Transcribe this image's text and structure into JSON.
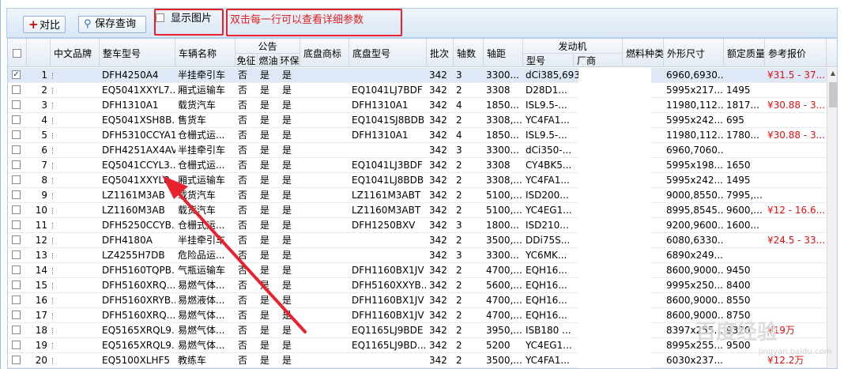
{
  "toolbar": {
    "compare_label": "对比",
    "save_query_label": "保存查询",
    "show_pic_label": "显示图片",
    "hint": "双击每一行可以查看详细参数"
  },
  "colors": {
    "hint_red": "#e02020",
    "price_red": "#e01010",
    "selected_row": "#dfe8f6",
    "annotation_red": "#e8232f"
  },
  "columns": {
    "cn_brand": "中文品牌",
    "model": "整车型号",
    "vehicle_name": "车辆名称",
    "announcement": "公告",
    "ann_exempt": "免征",
    "ann_fuel": "燃油",
    "ann_env": "环保",
    "chassis_brand": "底盘商标",
    "chassis_model": "底盘型号",
    "batch": "批次",
    "axles": "轴数",
    "wheelbase": "轴距",
    "engine": "发动机",
    "engine_model": "型号",
    "engine_maker": "厂商",
    "fuel_type": "燃料种类",
    "dimensions": "外形尺寸",
    "rated_mass": "额定质量",
    "ref_price": "参考报价"
  },
  "rows": [
    {
      "n": "1",
      "model": "DFH4250A4",
      "name": "半挂牵引车",
      "ex": "否",
      "fu": "是",
      "en": "是",
      "chassis": "",
      "batch": "342",
      "axles": "3",
      "wb": "3300...",
      "eng": "dCi385,6930...",
      "dim": "6960,6930...",
      "mass": "",
      "price": "¥31.5 - 37..."
    },
    {
      "n": "2",
      "model": "EQ5041XXYL7...",
      "name": "厢式运输车",
      "ex": "否",
      "fu": "是",
      "en": "是",
      "chassis": "EQ1041LJ7BDF",
      "batch": "342",
      "axles": "2",
      "wb": "3308",
      "eng": "D28D1...",
      "dim": "5995x217...",
      "mass": "1495",
      "price": ""
    },
    {
      "n": "3",
      "model": "DFH1310A1",
      "name": "载货汽车",
      "ex": "否",
      "fu": "是",
      "en": "是",
      "chassis": "DFH1310A1",
      "batch": "342",
      "axles": "4",
      "wb": "1850...",
      "eng": "ISL9.5-...",
      "dim": "11980,112...",
      "mass": "1817...",
      "price": "¥30.88 - 3..."
    },
    {
      "n": "4",
      "model": "EQ5041XSH8B...",
      "name": "售货车",
      "ex": "否",
      "fu": "是",
      "en": "是",
      "chassis": "EQ1041SJ8BDB",
      "batch": "342",
      "axles": "2",
      "wb": "3308,...",
      "eng": "YC4FA1...",
      "dim": "5995x242...",
      "mass": "695",
      "price": ""
    },
    {
      "n": "5",
      "model": "DFH5310CCYA1",
      "name": "仓栅式运...",
      "ex": "否",
      "fu": "是",
      "en": "是",
      "chassis": "DFH1310A1",
      "batch": "342",
      "axles": "4",
      "wb": "1850...",
      "eng": "ISL9.5-...",
      "dim": "11980,112...",
      "mass": "1780...",
      "price": "¥30.88 - 3..."
    },
    {
      "n": "6",
      "model": "DFH4251AX4AV",
      "name": "半挂牵引车",
      "ex": "否",
      "fu": "是",
      "en": "是",
      "chassis": "",
      "batch": "342",
      "axles": "3",
      "wb": "3300...",
      "eng": "dCi350-...",
      "dim": "6960,7060...",
      "mass": "",
      "price": ""
    },
    {
      "n": "7",
      "model": "EQ5041CCYL3...",
      "name": "仓栅式运...",
      "ex": "否",
      "fu": "是",
      "en": "是",
      "chassis": "EQ1041LJ3BDF",
      "batch": "342",
      "axles": "2",
      "wb": "3308",
      "eng": "CY4BK5...",
      "dim": "5995x198...",
      "mass": "1650",
      "price": ""
    },
    {
      "n": "8",
      "model": "EQ5041XXYL8...",
      "name": "厢式运输车",
      "ex": "否",
      "fu": "是",
      "en": "是",
      "chassis": "EQ1041LJ8BDB",
      "batch": "342",
      "axles": "2",
      "wb": "3308,...",
      "eng": "YC4FA1...",
      "dim": "5995x242...",
      "mass": "1495",
      "price": ""
    },
    {
      "n": "9",
      "model": "LZ1161M3AB",
      "name": "载货汽车",
      "ex": "否",
      "fu": "是",
      "en": "是",
      "chassis": "LZ1161M3ABT",
      "batch": "342",
      "axles": "2",
      "wb": "5100,...",
      "eng": "ISD200...",
      "dim": "9000,8550...",
      "mass": "7995,...",
      "price": ""
    },
    {
      "n": "10",
      "model": "LZ1160M3AB",
      "name": "载货汽车",
      "ex": "否",
      "fu": "是",
      "en": "是",
      "chassis": "LZ1160M3ABT",
      "batch": "342",
      "axles": "2",
      "wb": "5100,...",
      "eng": "YC4EG1...",
      "dim": "8995,8545...",
      "mass": "9600,...",
      "price": "¥12 - 16.6..."
    },
    {
      "n": "11",
      "model": "DFH5250CCYB...",
      "name": "仓栅式运...",
      "ex": "否",
      "fu": "是",
      "en": "是",
      "chassis": "DFH1250BXV",
      "batch": "342",
      "axles": "3",
      "wb": "1800...",
      "eng": "ISD210...",
      "dim": "9200,9600...",
      "mass": "1600...",
      "price": ""
    },
    {
      "n": "12",
      "model": "DFH4180A",
      "name": "半挂牵引车",
      "ex": "否",
      "fu": "是",
      "en": "是",
      "chassis": "",
      "batch": "342",
      "axles": "2",
      "wb": "3500,...",
      "eng": "DDi75S...",
      "dim": "6080,6330...",
      "mass": "",
      "price": "¥24.5 - 33..."
    },
    {
      "n": "13",
      "model": "LZ4255H7DB",
      "name": "危险品运...",
      "ex": "否",
      "fu": "是",
      "en": "是",
      "chassis": "",
      "batch": "342",
      "axles": "3",
      "wb": "3300...",
      "eng": "YC6MK...",
      "dim": "6890x249...",
      "mass": "",
      "price": ""
    },
    {
      "n": "14",
      "model": "DFH5160TQPB...",
      "name": "气瓶运输车",
      "ex": "否",
      "fu": "是",
      "en": "是",
      "chassis": "DFH1160BX1JV",
      "batch": "342",
      "axles": "2",
      "wb": "4700,...",
      "eng": "EQH16...",
      "dim": "8600,9000...",
      "mass": "9450",
      "price": ""
    },
    {
      "n": "15",
      "model": "DFH5160XRQ...",
      "name": "易燃气体...",
      "ex": "否",
      "fu": "是",
      "en": "是",
      "chassis": "DFH5160XXYB...",
      "batch": "342",
      "axles": "2",
      "wb": "5600,...",
      "eng": "EQH16...",
      "dim": "9995x250...",
      "mass": "8400",
      "price": ""
    },
    {
      "n": "16",
      "model": "DFH5160XRYB...",
      "name": "易燃液体...",
      "ex": "否",
      "fu": "是",
      "en": "是",
      "chassis": "DFH1160BX1JV",
      "batch": "342",
      "axles": "2",
      "wb": "4700,...",
      "eng": "EQH16...",
      "dim": "8600,9000...",
      "mass": "8550",
      "price": ""
    },
    {
      "n": "17",
      "model": "DFH5160XRQ...",
      "name": "易燃气体...",
      "ex": "否",
      "fu": "是",
      "en": "是",
      "chassis": "DFH1160BX1JV",
      "batch": "342",
      "axles": "2",
      "wb": "4700,...",
      "eng": "EQH16...",
      "dim": "8600,9000...",
      "mass": "8750",
      "price": ""
    },
    {
      "n": "18",
      "model": "EQ5165XRQL9...",
      "name": "易燃气体...",
      "ex": "否",
      "fu": "是",
      "en": "是",
      "chassis": "EQ1165LJ9BDE",
      "batch": "342",
      "axles": "2",
      "wb": "3950,...",
      "eng": "ISB180 ...",
      "dim": "8397x255...",
      "mass": "9320",
      "price": "¥19万"
    },
    {
      "n": "19",
      "model": "EQ5165XRQL9...",
      "name": "易燃气体...",
      "ex": "否",
      "fu": "是",
      "en": "是",
      "chassis": "EQ1165LJ9BD...",
      "batch": "342",
      "axles": "2",
      "wb": "5200",
      "eng": "YC4EG1...",
      "dim": "8995x255...",
      "mass": "9500",
      "price": ""
    },
    {
      "n": "20",
      "model": "EQ5100XLHF5",
      "name": "教练车",
      "ex": "否",
      "fu": "是",
      "en": "是",
      "chassis": "",
      "batch": "342",
      "axles": "2",
      "wb": "3500,...",
      "eng": "YC4FA1...",
      "dim": "6030x237...",
      "mass": "",
      "price": "¥12.2万"
    }
  ],
  "watermark": {
    "text": "百度经验",
    "url": "jingyan.baidu.com"
  }
}
